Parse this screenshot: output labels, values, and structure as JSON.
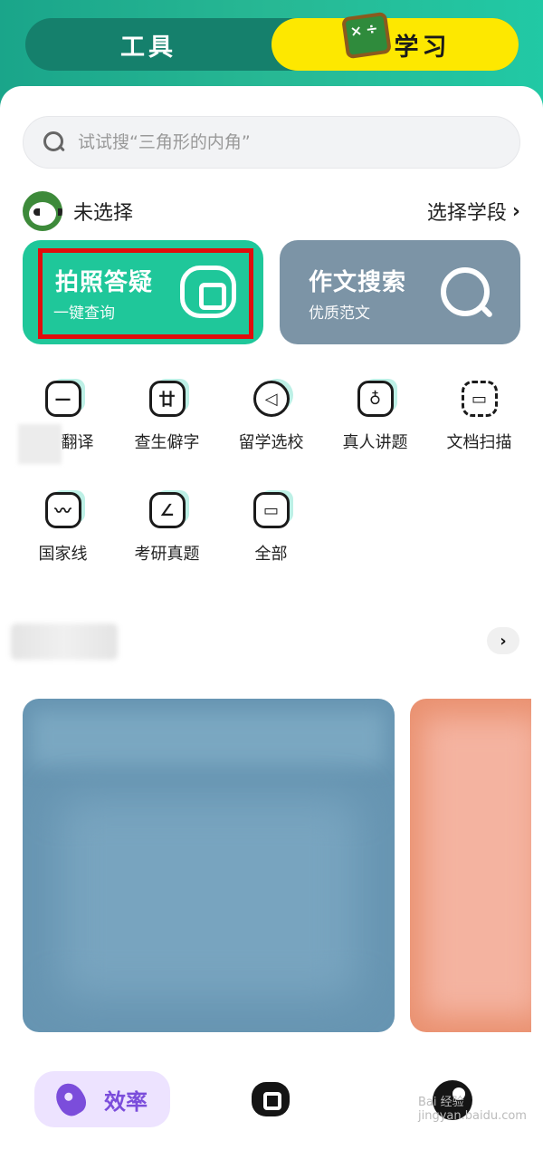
{
  "header": {
    "tab_tools": "工具",
    "tab_study": "学习",
    "study_icon_text": "×÷"
  },
  "search": {
    "placeholder": "试试搜“三角形的内角”"
  },
  "grade": {
    "value": "未选择",
    "action": "选择学段",
    "chevron": "›"
  },
  "cards": [
    {
      "title": "拍照答疑",
      "subtitle": "一键查询",
      "icon": "camera-icon",
      "color": "#1fc79a",
      "highlighted": true
    },
    {
      "title": "作文搜索",
      "subtitle": "优质范文",
      "icon": "magnifier-icon",
      "color": "#7c94a6"
    }
  ],
  "tools": [
    {
      "label": "翻译",
      "icon": "chat-bubble-icon",
      "glyph": "—"
    },
    {
      "label": "查生僻字",
      "icon": "character-icon",
      "glyph": "廿"
    },
    {
      "label": "留学选校",
      "icon": "send-icon",
      "glyph": "◁"
    },
    {
      "label": "真人讲题",
      "icon": "person-icon",
      "glyph": "♁"
    },
    {
      "label": "文档扫描",
      "icon": "scan-icon",
      "glyph": "▭"
    },
    {
      "label": "国家线",
      "icon": "trend-icon",
      "glyph": "〰"
    },
    {
      "label": "考研真题",
      "icon": "edit-icon",
      "glyph": "∠"
    },
    {
      "label": "全部",
      "icon": "folder-icon",
      "glyph": "▭"
    }
  ],
  "section": {
    "more_chevron": "›"
  },
  "bottom_nav": {
    "efficiency_label": "效率"
  },
  "watermark": "Bai 经验 jingyan.baidu.com",
  "colors": {
    "accent_green": "#1fc79a",
    "tab_yellow": "#fde800",
    "highlight_red": "#e10c0c",
    "nav_purple": "#7b4ddb"
  }
}
